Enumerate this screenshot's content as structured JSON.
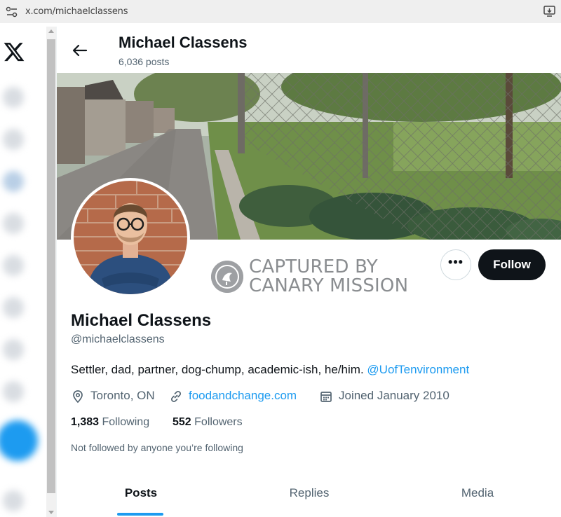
{
  "browser": {
    "url": "x.com/michaelclassens"
  },
  "header": {
    "name": "Michael Classens",
    "posts": "6,036 posts"
  },
  "profile": {
    "display_name": "Michael Classens",
    "handle": "@michaelclassens",
    "bio": "Settler, dad, partner, dog-chump, academic-ish, he/him.",
    "bio_mention": "@UofTenvironment",
    "location": "Toronto, ON",
    "website": "foodandchange.com",
    "joined": "Joined January 2010",
    "following_count": "1,383",
    "following_label": "Following",
    "followers_count": "552",
    "followers_label": "Followers",
    "not_followed": "Not followed by anyone you’re following"
  },
  "actions": {
    "more": "•••",
    "follow": "Follow"
  },
  "watermark": {
    "line1": "CAPTURED BY",
    "line2": "CANARY MISSION"
  },
  "tabs": [
    {
      "label": "Posts",
      "active": true
    },
    {
      "label": "Replies",
      "active": false
    },
    {
      "label": "Media",
      "active": false
    }
  ],
  "colors": {
    "accent": "#1d9bf0",
    "text": "#0f1419",
    "muted": "#536471",
    "follow_bg": "#0f1419"
  },
  "icons": [
    "site-settings-icon",
    "install-app-icon",
    "x-logo-icon",
    "back-arrow-icon",
    "location-icon",
    "link-icon",
    "calendar-icon",
    "canary-mission-logo"
  ]
}
